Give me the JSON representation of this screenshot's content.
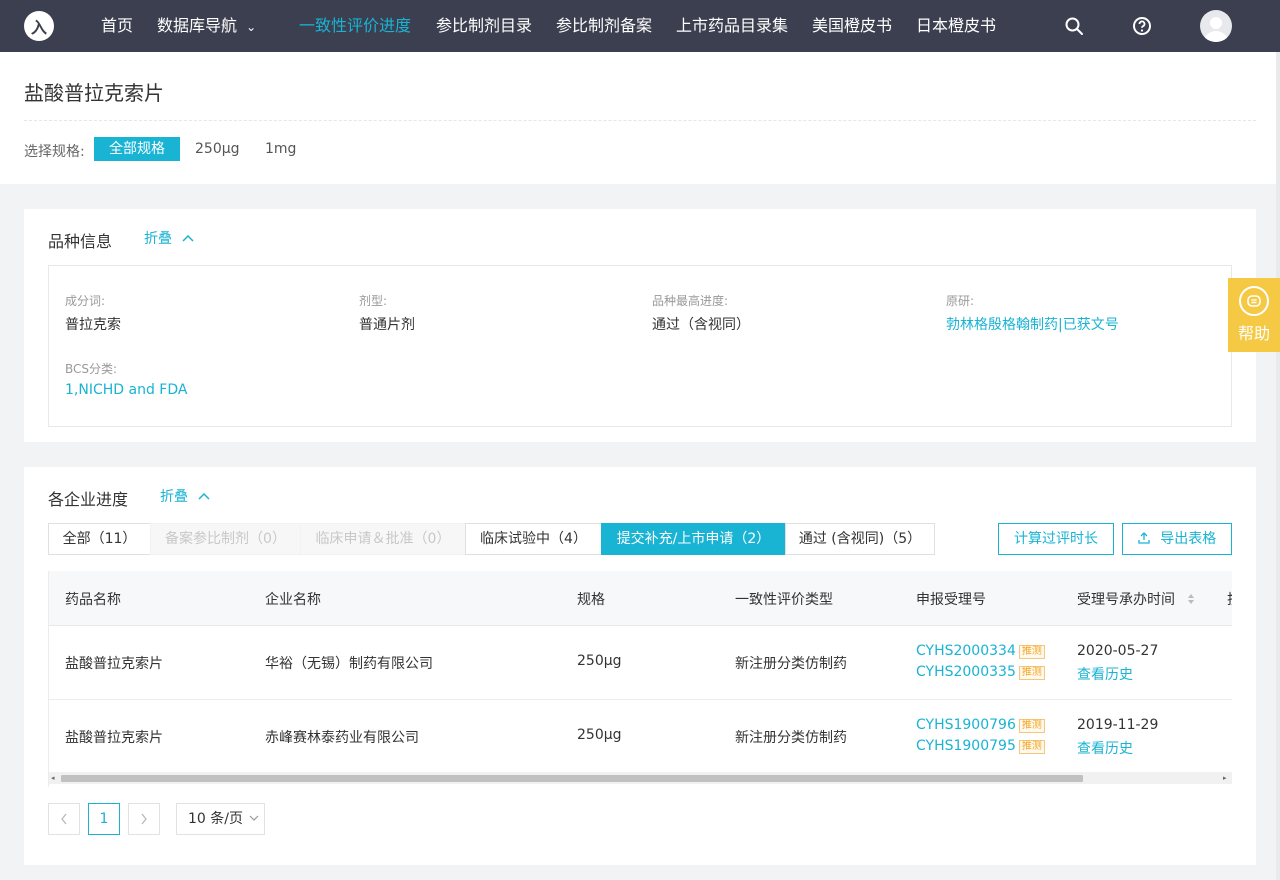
{
  "nav": {
    "logo_text": "入",
    "items": [
      "首页",
      "数据库导航",
      "一致性评价进度",
      "参比制剂目录",
      "参比制剂备案",
      "上市药品目录集",
      "美国橙皮书",
      "日本橙皮书"
    ],
    "active_index": 2,
    "dropdown_arrow": "⌄",
    "icons": [
      "search-icon",
      "help-circle-icon",
      "user-avatar-icon"
    ]
  },
  "page": {
    "title": "盐酸普拉克索片",
    "spec_label": "选择规格:",
    "spec_options": [
      "全部规格",
      "250μg",
      "1mg"
    ],
    "spec_selected": "全部规格"
  },
  "variety": {
    "title": "品种信息",
    "fold_label": "折叠",
    "fields": [
      {
        "label": "成分词:",
        "value": "普拉克索"
      },
      {
        "label": "剂型:",
        "value": "普通片剂"
      },
      {
        "label": "品种最高进度:",
        "value": "通过（含视同）"
      },
      {
        "label": "原研:",
        "value": "勃林格殷格翰制药|已获文号"
      },
      {
        "label": "BCS分类:",
        "value": "1,NICHD and FDA"
      }
    ]
  },
  "help": {
    "label": "帮助"
  },
  "progress": {
    "title": "各企业进度",
    "fold_label": "折叠",
    "tabs": [
      "全部（11）",
      "备案参比制剂（0）",
      "临床申请＆批准（0）",
      "临床试验中（4）",
      "提交补充/上市申请（2）",
      "通过 (含视同)（5）"
    ],
    "active_tab": "提交补充/上市申请（2）",
    "calc_button": "计算过评时长",
    "export_button": "导出表格",
    "columns": [
      "药品名称",
      "企业名称",
      "规格",
      "一致性评价类型",
      "申报受理号",
      "受理号承办时间",
      "技"
    ],
    "rows": [
      {
        "drug": "盐酸普拉克索片",
        "company": "华裕（无锡）制药有限公司",
        "spec": "250μg",
        "type": "新注册分类仿制药",
        "acceptance_numbers": [
          "CYHS2000334",
          "CYHS2000335"
        ],
        "tag": "推测",
        "date": "2020-05-27",
        "history_link": "查看历史"
      },
      {
        "drug": "盐酸普拉克索片",
        "company": "赤峰赛林泰药业有限公司",
        "spec": "250μg",
        "type": "新注册分类仿制药",
        "acceptance_numbers": [
          "CYHS1900796",
          "CYHS1900795"
        ],
        "tag": "推测",
        "date": "2019-11-29",
        "history_link": "查看历史"
      }
    ],
    "pagination": {
      "current_page": "1",
      "page_size": "10 条/页"
    }
  },
  "colors": {
    "nav_bg": "#3c3f4f",
    "accent": "#19b3d4",
    "help_bg": "#f6c945",
    "tag": "#f5a623"
  }
}
